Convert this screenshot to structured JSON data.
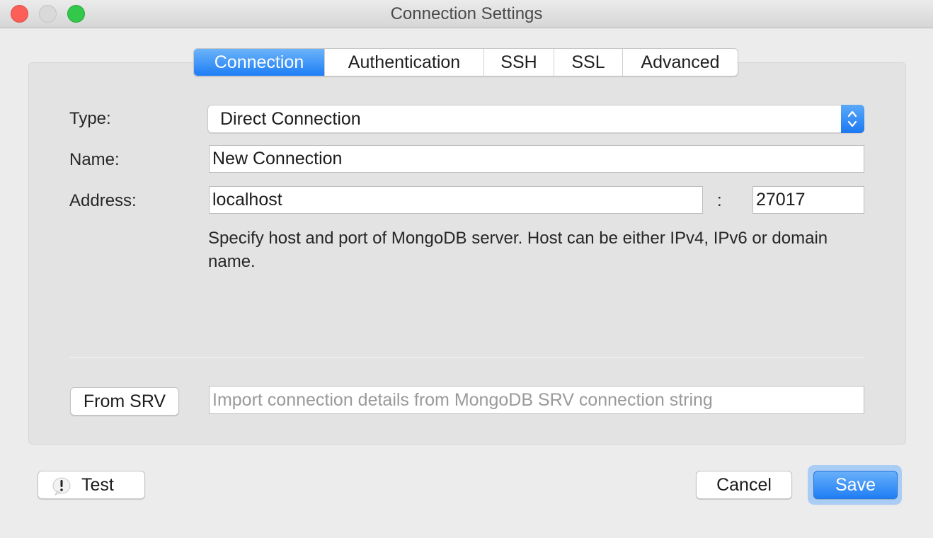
{
  "window": {
    "title": "Connection Settings"
  },
  "tabs": [
    {
      "label": "Connection",
      "active": true
    },
    {
      "label": "Authentication",
      "active": false
    },
    {
      "label": "SSH",
      "active": false
    },
    {
      "label": "SSL",
      "active": false
    },
    {
      "label": "Advanced",
      "active": false
    }
  ],
  "form": {
    "type_label": "Type:",
    "type_value": "Direct Connection",
    "name_label": "Name:",
    "name_value": "New Connection",
    "address_label": "Address:",
    "host_value": "localhost",
    "separator": ":",
    "port_value": "27017",
    "help_text": "Specify host and port of MongoDB server. Host can be either IPv4, IPv6 or domain name."
  },
  "srv": {
    "button_label": "From SRV",
    "placeholder": "Import connection details from MongoDB SRV connection string",
    "value": ""
  },
  "footer": {
    "test_label": "Test",
    "test_icon": "warning-icon",
    "cancel_label": "Cancel",
    "save_label": "Save"
  },
  "colors": {
    "accent": "#1d7ef5",
    "close": "#fc5f57",
    "minimize": "#d9d9d9",
    "maximize": "#34c84a"
  }
}
